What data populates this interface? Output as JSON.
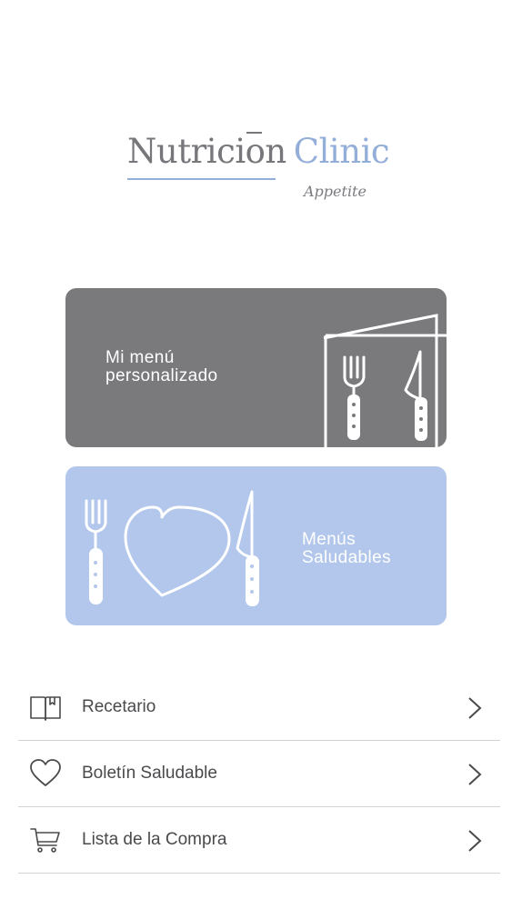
{
  "logo": {
    "word1": "Nutricion",
    "word2": "Clinic",
    "tagline": "Appetite"
  },
  "cards": [
    {
      "title": "Mi menú\npersonalizado",
      "icons": [
        "menu-book-icon",
        "fork-icon",
        "knife-icon"
      ],
      "color": "#7a797c"
    },
    {
      "title": "Menús\nSaludables",
      "icons": [
        "fork-icon",
        "heart-icon",
        "knife-icon"
      ],
      "color": "#b2c7eb"
    }
  ],
  "list": [
    {
      "label": "Recetario",
      "icon": "book-icon"
    },
    {
      "label": "Boletín Saludable",
      "icon": "heart-outline-icon"
    },
    {
      "label": "Lista de la Compra",
      "icon": "cart-icon"
    }
  ],
  "colors": {
    "accent_blue": "#93aed9",
    "card_gray": "#7a797c",
    "card_blue": "#b2c7eb",
    "text_dark": "#4a4a4d",
    "divider": "#d3d3d6"
  }
}
